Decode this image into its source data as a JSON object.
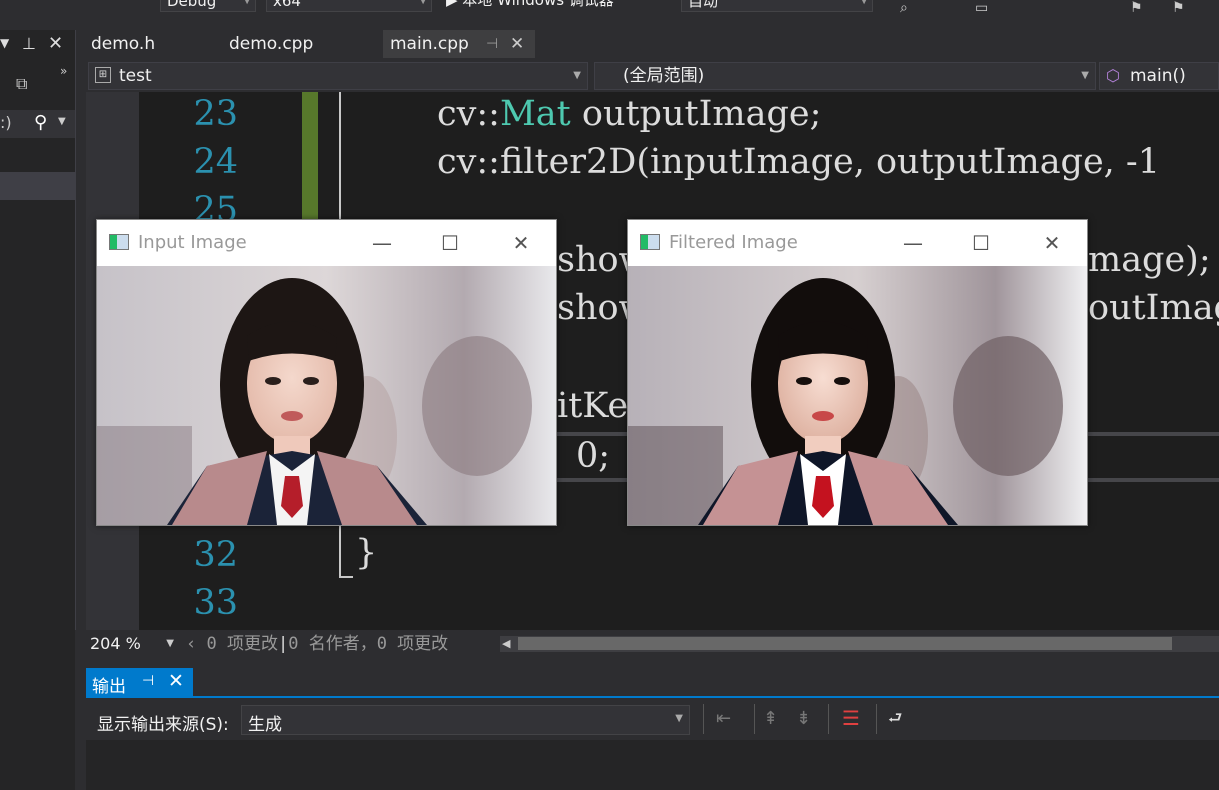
{
  "toolbar": {
    "config": "Debug",
    "platform": "x64",
    "run_label": "▶ 本地 Windows 调试器",
    "run_mode": "自动"
  },
  "tabs": [
    {
      "label": "demo.h"
    },
    {
      "label": "demo.cpp"
    },
    {
      "label": "main.cpp"
    }
  ],
  "nav": {
    "project": "test",
    "scope": "(全局范围)",
    "member": "main()"
  },
  "editor": {
    "lines": [
      {
        "no": "23",
        "pre": "cv::",
        "type": "Mat",
        "post": " outputImage;"
      },
      {
        "no": "24",
        "pre": "cv::filter2D(inputImage, outputImage, -1",
        "type": "",
        "post": ""
      },
      {
        "no": "25",
        "pre": "",
        "type": "",
        "post": ""
      },
      {
        "no": "32",
        "pre": "}",
        "type": "",
        "post": ""
      },
      {
        "no": "33",
        "pre": "",
        "type": "",
        "post": ""
      }
    ],
    "behind": {
      "l1_left": "show",
      "l1_right": "mage);",
      "l2_left": "show",
      "l2_right": "outImage",
      "l3_left": "itKe",
      "l4_left": "0;"
    }
  },
  "status": {
    "zoom": "204 %",
    "changes": "0 项更改",
    "authors": "0 名作者，0 项更改"
  },
  "output": {
    "tab_label": "输出",
    "source_label": "显示输出来源(S):",
    "source_value": "生成"
  },
  "windows": {
    "input": {
      "title": "Input Image"
    },
    "filtered": {
      "title": "Filtered Image"
    }
  },
  "icons": {
    "minimize": "—",
    "maximize": "☐",
    "close": "✕"
  },
  "colors": {
    "accent": "#007acc",
    "line_number": "#2b91af",
    "type_name": "#4ec9b0",
    "change_bar": "#57782b"
  }
}
